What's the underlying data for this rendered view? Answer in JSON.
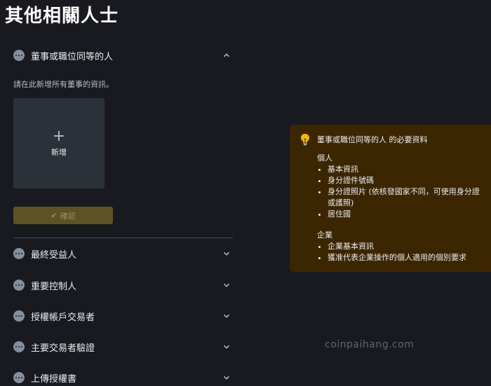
{
  "page": {
    "title": "其他相關人士"
  },
  "sections": {
    "directors": {
      "label": "董事或職位同等的人",
      "expanded": true
    },
    "beneficial_owners": {
      "label": "最終受益人"
    },
    "controllers": {
      "label": "重要控制人"
    },
    "authorized_traders": {
      "label": "授權帳戶交易者"
    },
    "primary_trader": {
      "label": "主要交易者驗證"
    },
    "authorization_letter": {
      "label": "上傳授權書"
    }
  },
  "directors_panel": {
    "hint": "請在此新增所有董事的資訊。",
    "add_label": "新增",
    "confirm_label": "確認"
  },
  "tip": {
    "title": "董事或職位同等的人 的必要資料",
    "individual": {
      "label": "個人",
      "items": [
        "基本資訊",
        "身分證件號碼",
        "身分證照片 (依核發國家不同，可使用身分證或護照)",
        "居住國"
      ]
    },
    "corporate": {
      "label": "企業",
      "items": [
        "企業基本資訊",
        "獲准代表企業操作的個人適用的個別要求"
      ]
    }
  },
  "watermark": "coinpaihang.com",
  "colors": {
    "background": "#181a20",
    "card": "#2b3139",
    "tip_bg": "#3c2601",
    "accent": "#f0b90b"
  }
}
